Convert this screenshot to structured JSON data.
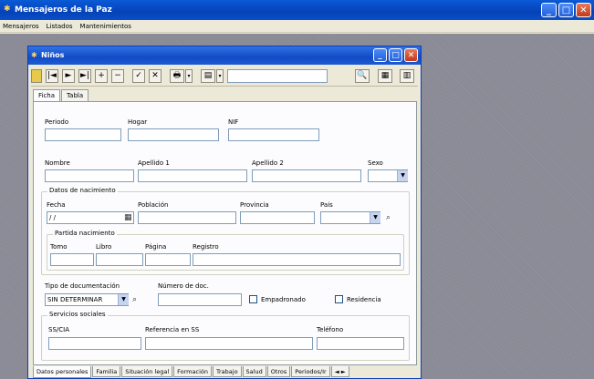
{
  "app": {
    "title": "Mensajeros de la Paz",
    "menu": [
      "Mensajeros",
      "Listados",
      "Mantenimientos"
    ],
    "min_glyph": "_",
    "max_glyph": "□",
    "close_glyph": "✕"
  },
  "child": {
    "title": "Niños",
    "min_glyph": "_",
    "max_glyph": "□",
    "close_glyph": "✕"
  },
  "toolbar": {
    "first": "|◄",
    "play": "►",
    "last": "►|",
    "add": "+",
    "remove": "−",
    "accept": "✓",
    "cancel": "✕",
    "print": "🖶",
    "print_arrow": "▾",
    "preview": "▤",
    "preview_arrow": "▾",
    "find": "🔍",
    "grid": "▦",
    "book": "▥",
    "search_value": ""
  },
  "tabs_top": [
    "Ficha",
    "Tabla"
  ],
  "form": {
    "periodo_label": "Periodo",
    "periodo_value": "",
    "hogar_label": "Hogar",
    "hogar_value": "",
    "nif_label": "NIF",
    "nif_value": "",
    "nombre_label": "Nombre",
    "nombre_value": "",
    "apellido1_label": "Apellido 1",
    "apellido1_value": "",
    "apellido2_label": "Apellido 2",
    "apellido2_value": "",
    "sexo_label": "Sexo",
    "sexo_value": "",
    "nacimiento_title": "Datos de nacimiento",
    "fecha_label": "Fecha",
    "fecha_value": "/ /",
    "poblacion_label": "Población",
    "poblacion_value": "",
    "provincia_label": "Provincia",
    "provincia_value": "",
    "pais_label": "Pais",
    "pais_value": "",
    "partida_title": "Partida nacimiento",
    "tomo_label": "Tomo",
    "tomo_value": "",
    "libro_label": "Libro",
    "libro_value": "",
    "pagina_label": "Página",
    "pagina_value": "",
    "registro_label": "Registro",
    "registro_value": "",
    "tipo_doc_label": "Tipo de documentación",
    "tipo_doc_value": "SIN DETERMINAR",
    "num_doc_label": "Número de doc.",
    "num_doc_value": "",
    "empadronado_label": "Empadronado",
    "residencia_label": "Residencia",
    "servicios_title": "Servicios sociales",
    "ss_cia_label": "SS/CIA",
    "ss_cia_value": "",
    "referencia_label": "Referencia en SS",
    "referencia_value": "",
    "telefono_label": "Teléfono",
    "telefono_value": ""
  },
  "tabs_bottom": [
    "Datos personales",
    "Familia",
    "Situación legal",
    "Formación",
    "Trabajo",
    "Salud",
    "Otros",
    "Periodos/Ir"
  ],
  "tabs_bottom_scroll": "◄ ►"
}
